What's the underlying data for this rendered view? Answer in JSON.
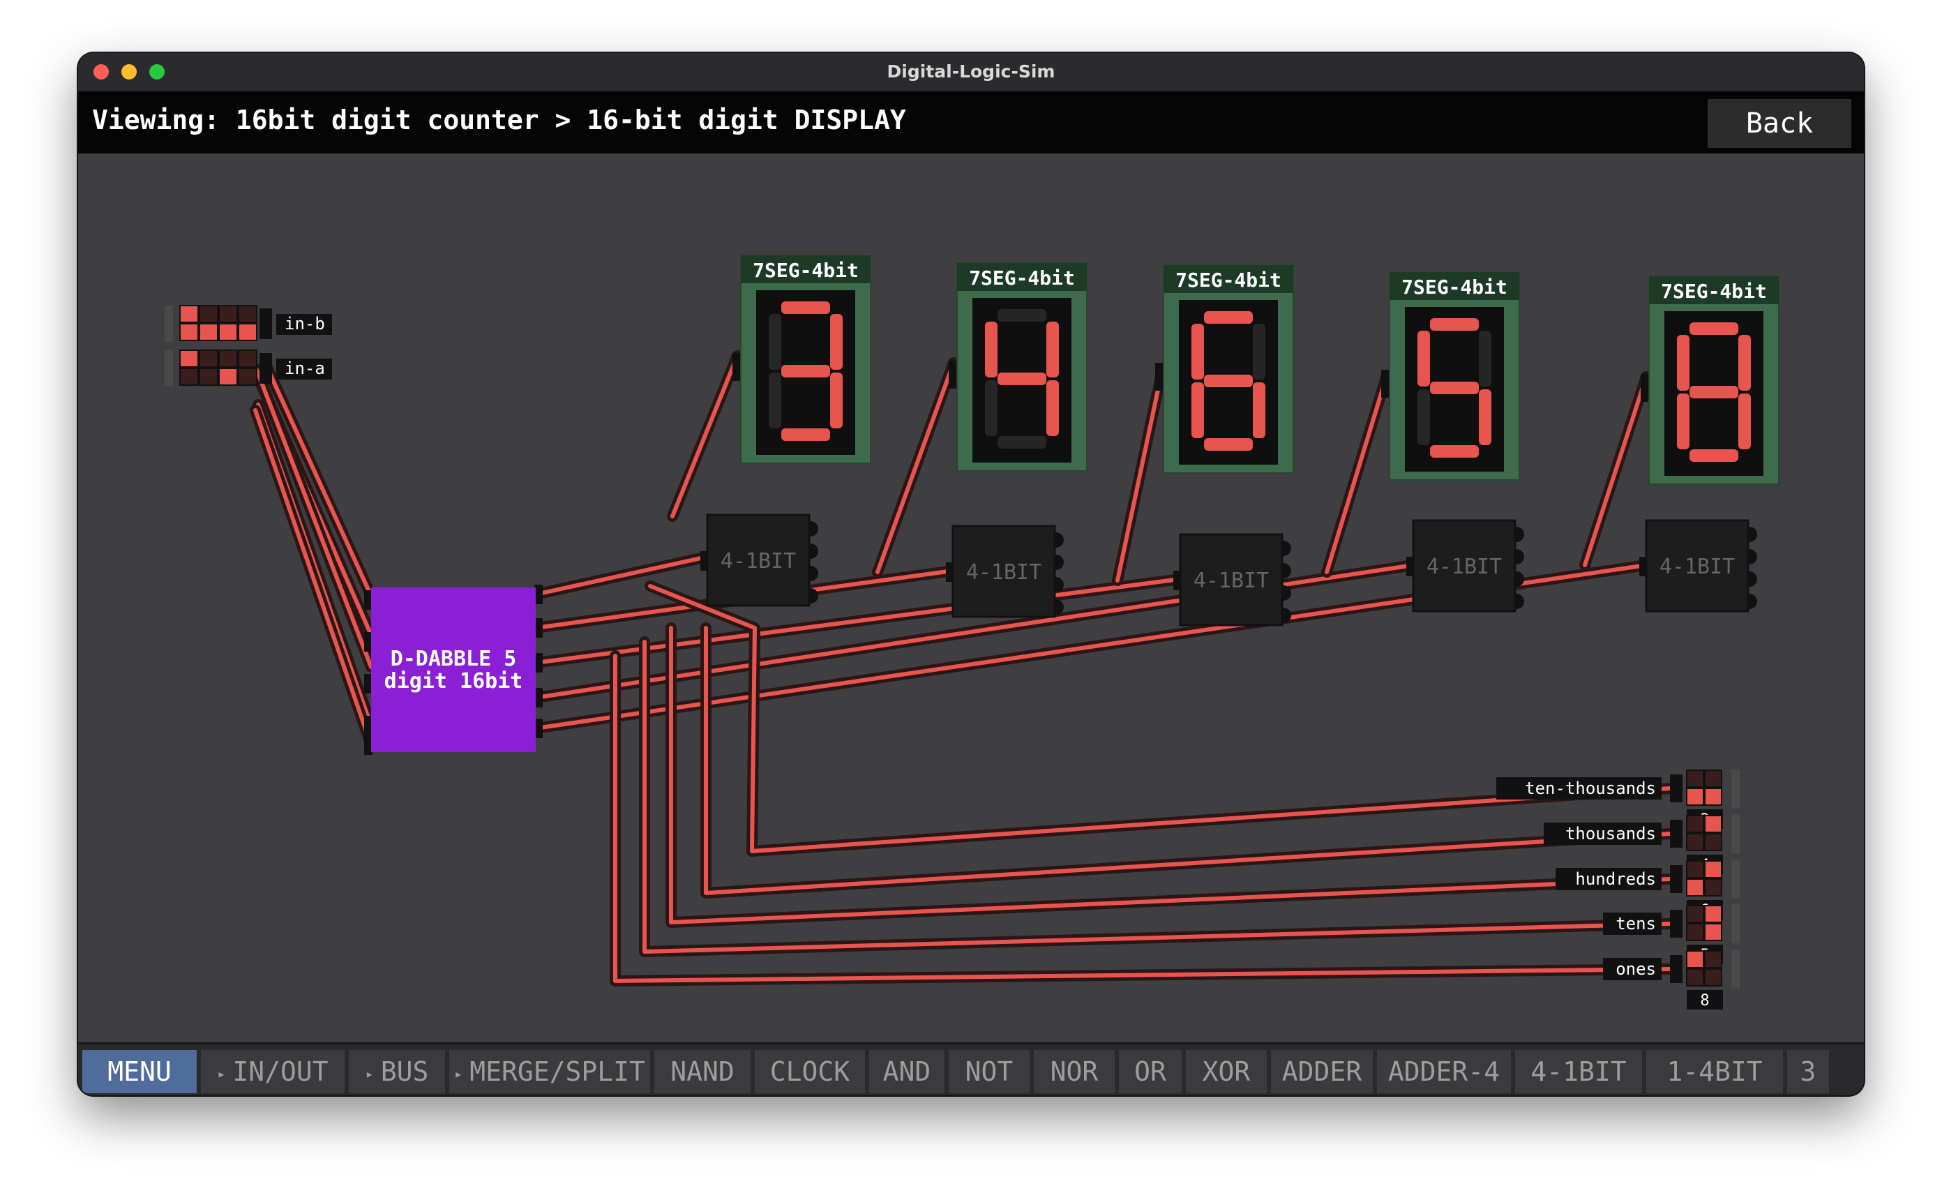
{
  "window": {
    "title": "Digital-Logic-Sim"
  },
  "header": {
    "viewing_text": "Viewing: 16bit digit counter > 16-bit digit DISPLAY",
    "back_label": "Back"
  },
  "inputs": [
    {
      "label": "in-b"
    },
    {
      "label": "in-a"
    }
  ],
  "dabble": {
    "line1": "D-DABBLE 5",
    "line2": "digit 16bit"
  },
  "displays": [
    {
      "title": "7SEG-4bit",
      "digit": "3"
    },
    {
      "title": "7SEG-4bit",
      "digit": "4"
    },
    {
      "title": "7SEG-4bit",
      "digit": "6"
    },
    {
      "title": "7SEG-4bit",
      "digit": "5"
    },
    {
      "title": "7SEG-4bit",
      "digit": "8"
    }
  ],
  "converters": [
    {
      "label": "4-1BIT"
    },
    {
      "label": "4-1BIT"
    },
    {
      "label": "4-1BIT"
    },
    {
      "label": "4-1BIT"
    },
    {
      "label": "4-1BIT"
    }
  ],
  "outputs": [
    {
      "label": "ten-thousands",
      "value": "3"
    },
    {
      "label": "thousands",
      "value": "4"
    },
    {
      "label": "hundreds",
      "value": "6"
    },
    {
      "label": "tens",
      "value": "5"
    },
    {
      "label": "ones",
      "value": "8"
    }
  ],
  "colors": {
    "wire_on": "#e8554e",
    "wire_shadow": "#2a1616",
    "chip": "#8b1fd6",
    "display_bezel": "#3e6b4c"
  },
  "toolbar": {
    "items": [
      {
        "label": "MENU",
        "active": true
      },
      {
        "label": "IN/OUT",
        "arrow": "▸"
      },
      {
        "label": "BUS",
        "arrow": "▸"
      },
      {
        "label": "MERGE/SPLIT",
        "arrow": "▸"
      },
      {
        "label": "NAND"
      },
      {
        "label": "CLOCK"
      },
      {
        "label": "AND"
      },
      {
        "label": "NOT"
      },
      {
        "label": "NOR"
      },
      {
        "label": "OR"
      },
      {
        "label": "XOR"
      },
      {
        "label": "ADDER"
      },
      {
        "label": "ADDER-4"
      },
      {
        "label": "4-1BIT"
      },
      {
        "label": "1-4BIT"
      },
      {
        "label": "3"
      }
    ]
  }
}
